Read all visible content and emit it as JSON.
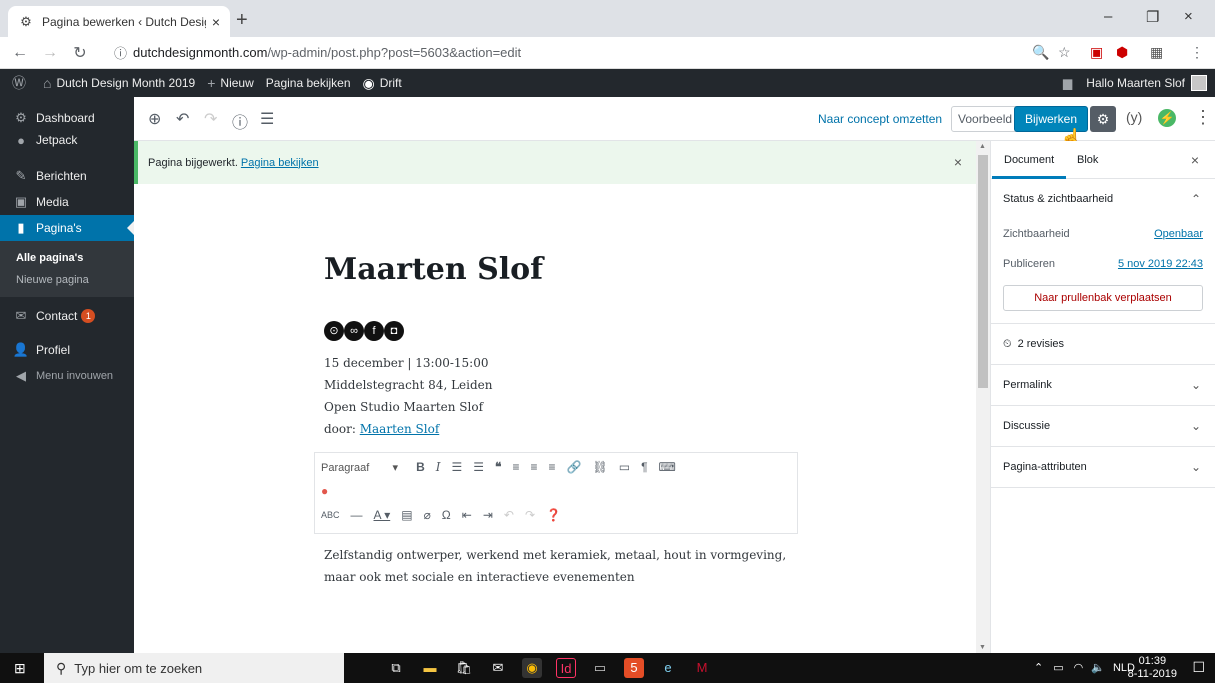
{
  "browser": {
    "tab_title": "Pagina bewerken ‹ Dutch Design",
    "tab_close": "×",
    "new_tab": "+",
    "url_host": "dutchdesignmonth.com",
    "url_path": "/wp-admin/post.php?post=5603&action=edit",
    "window_minimize": "–",
    "window_restore": "❐",
    "window_close": "×"
  },
  "adminbar": {
    "site_name": "Dutch Design Month 2019",
    "new_label": "Nieuw",
    "view_page": "Pagina bekijken",
    "drift": "Drift",
    "greeting": "Hallo Maarten Slof"
  },
  "sidebar": {
    "items": [
      {
        "label": "Dashboard",
        "icon": "⚙"
      },
      {
        "label": "Jetpack",
        "icon": "●"
      },
      {
        "label": "Berichten",
        "icon": "✎"
      },
      {
        "label": "Media",
        "icon": "▣"
      },
      {
        "label": "Pagina's",
        "icon": "▮"
      }
    ],
    "submenu": [
      "Alle pagina's",
      "Nieuwe pagina"
    ],
    "after": [
      {
        "label": "Contact",
        "icon": "✉",
        "badge": "1"
      },
      {
        "label": "Profiel",
        "icon": "👤"
      },
      {
        "label": "Menu invouwen",
        "icon": "◀"
      }
    ]
  },
  "header": {
    "concept": "Naar concept omzetten",
    "preview": "Voorbeeld",
    "update": "Bijwerken"
  },
  "notice": {
    "text": "Pagina bijgewerkt.",
    "link": "Pagina bekijken",
    "close": "×"
  },
  "content": {
    "title": "Maarten Slof",
    "date": "15 december | 13:00-15:00",
    "address": "Middelstegracht 84, Leiden",
    "event": "Open Studio Maarten Slof",
    "by_label": "door: ",
    "by_link": "Maarten Slof",
    "paragraph_select": "Paragraaf",
    "description": "Zelfstandig ontwerper, werkend met keramiek, metaal, hout in vormgeving, maar ook met sociale en interactieve evenementen"
  },
  "settings": {
    "tab_document": "Document",
    "tab_block": "Blok",
    "close": "×",
    "status_title": "Status & zichtbaarheid",
    "visibility_label": "Zichtbaarheid",
    "visibility_value": "Openbaar",
    "publish_label": "Publiceren",
    "publish_value": "5 nov 2019 22:43",
    "trash": "Naar prullenbak verplaatsen",
    "revisions": "2 revisies",
    "permalink": "Permalink",
    "discussion": "Discussie",
    "page_attributes": "Pagina-attributen"
  },
  "taskbar": {
    "search_placeholder": "Typ hier om te zoeken",
    "language": "NLD",
    "time": "01:39",
    "date": "8-11-2019"
  },
  "colors": {
    "wp_dark": "#23282d",
    "wp_blue": "#0073aa",
    "update_button": "#0085ba",
    "notice_green": "#4ab866"
  }
}
